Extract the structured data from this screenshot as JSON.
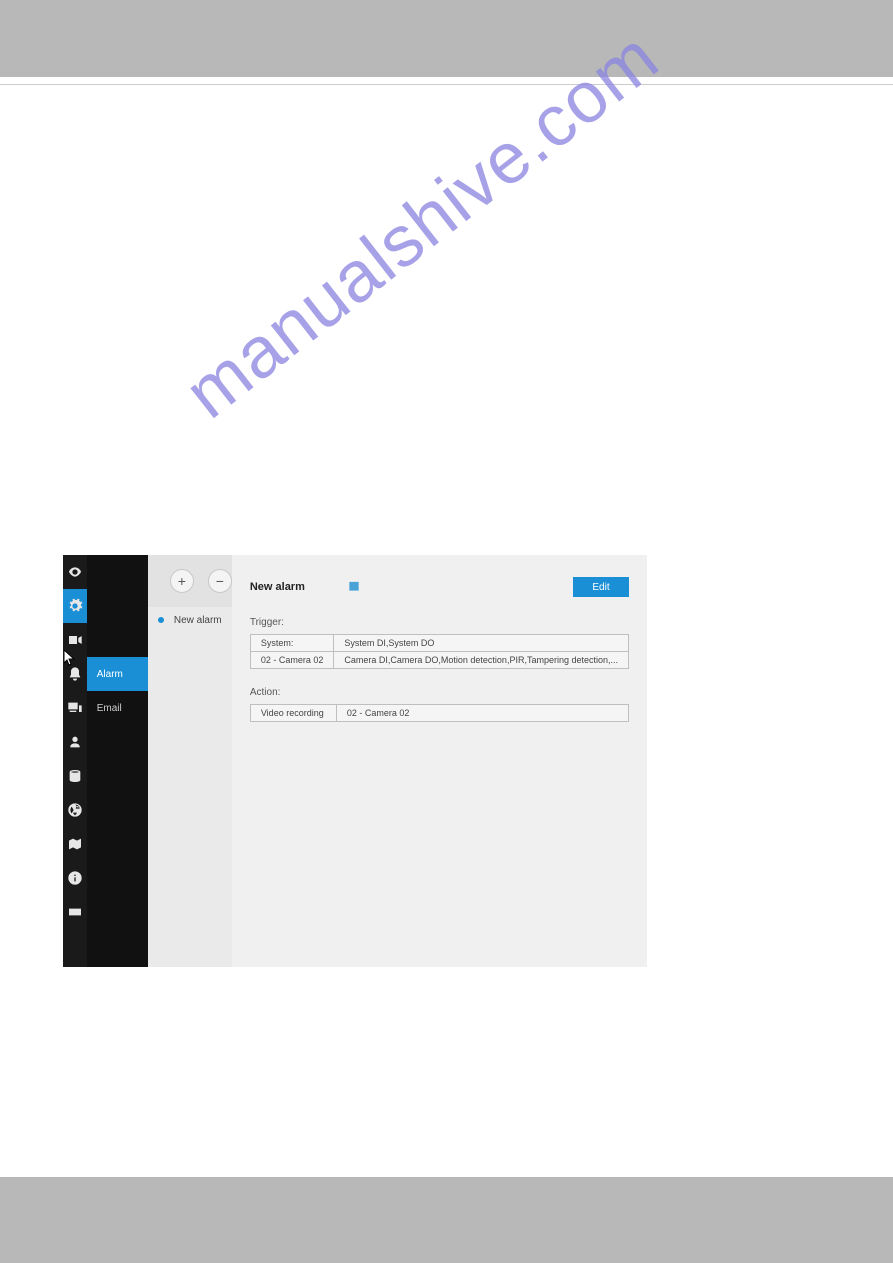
{
  "watermark": "manualshive.com",
  "subnav": {
    "alarm": "Alarm",
    "email": "Email"
  },
  "list": {
    "add_label": "+",
    "remove_label": "−",
    "item0": "New alarm"
  },
  "detail": {
    "title": "New alarm",
    "edit_label": "Edit",
    "trigger_label": "Trigger:",
    "action_label": "Action:",
    "trigger_rows": [
      {
        "k": "System:",
        "v": "System DI,System DO"
      },
      {
        "k": "02 - Camera 02",
        "v": "Camera DI,Camera DO,Motion detection,PIR,Tampering detection,..."
      }
    ],
    "action_rows": [
      {
        "k": "Video recording",
        "v": "02 - Camera 02"
      }
    ]
  }
}
